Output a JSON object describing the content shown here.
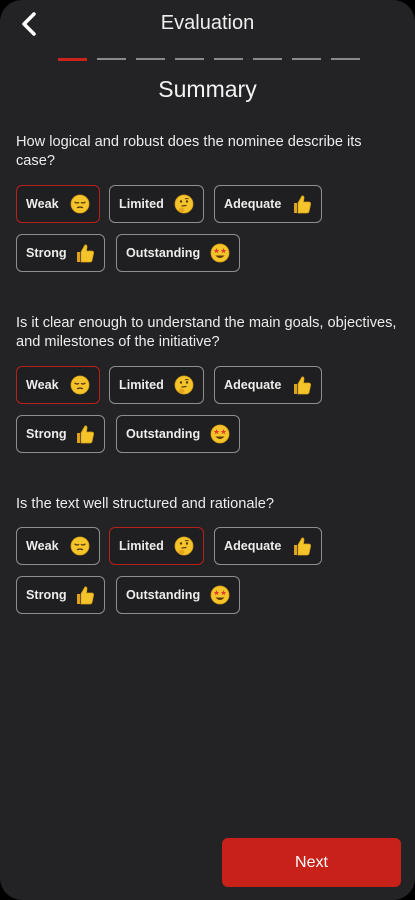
{
  "header": {
    "title": "Evaluation",
    "back_icon": "chevron-left-icon"
  },
  "progress": {
    "total_steps": 8,
    "current_step": 1
  },
  "summary_title": "Summary",
  "questions": [
    {
      "text": "How logical and robust does the nominee describe its case?",
      "selected": "Weak",
      "options": [
        {
          "label": "Weak",
          "icon": "pensive-face-emoji"
        },
        {
          "label": "Limited",
          "icon": "thinking-face-emoji"
        },
        {
          "label": "Adequate",
          "icon": "thumbs-up-emoji"
        },
        {
          "label": "Strong",
          "icon": "thumbs-up-emoji"
        },
        {
          "label": "Outstanding",
          "icon": "star-struck-emoji"
        }
      ]
    },
    {
      "text": "Is it clear enough to understand the main goals, objectives, and milestones of the initiative?",
      "selected": "Weak",
      "options": [
        {
          "label": "Weak",
          "icon": "pensive-face-emoji"
        },
        {
          "label": "Limited",
          "icon": "thinking-face-emoji"
        },
        {
          "label": "Adequate",
          "icon": "thumbs-up-emoji"
        },
        {
          "label": "Strong",
          "icon": "thumbs-up-emoji"
        },
        {
          "label": "Outstanding",
          "icon": "star-struck-emoji"
        }
      ]
    },
    {
      "text": "Is the text well structured and rationale?",
      "selected": "Limited",
      "options": [
        {
          "label": "Weak",
          "icon": "pensive-face-emoji"
        },
        {
          "label": "Limited",
          "icon": "thinking-face-emoji"
        },
        {
          "label": "Adequate",
          "icon": "thumbs-up-emoji"
        },
        {
          "label": "Strong",
          "icon": "thumbs-up-emoji"
        },
        {
          "label": "Outstanding",
          "icon": "star-struck-emoji"
        }
      ]
    }
  ],
  "next_label": "Next",
  "colors": {
    "background": "#232325",
    "accent": "#c8211a",
    "selected_border": "#b8201a",
    "unselected_border": "#8e8e8e",
    "emoji_yellow": "#f5c42a"
  }
}
